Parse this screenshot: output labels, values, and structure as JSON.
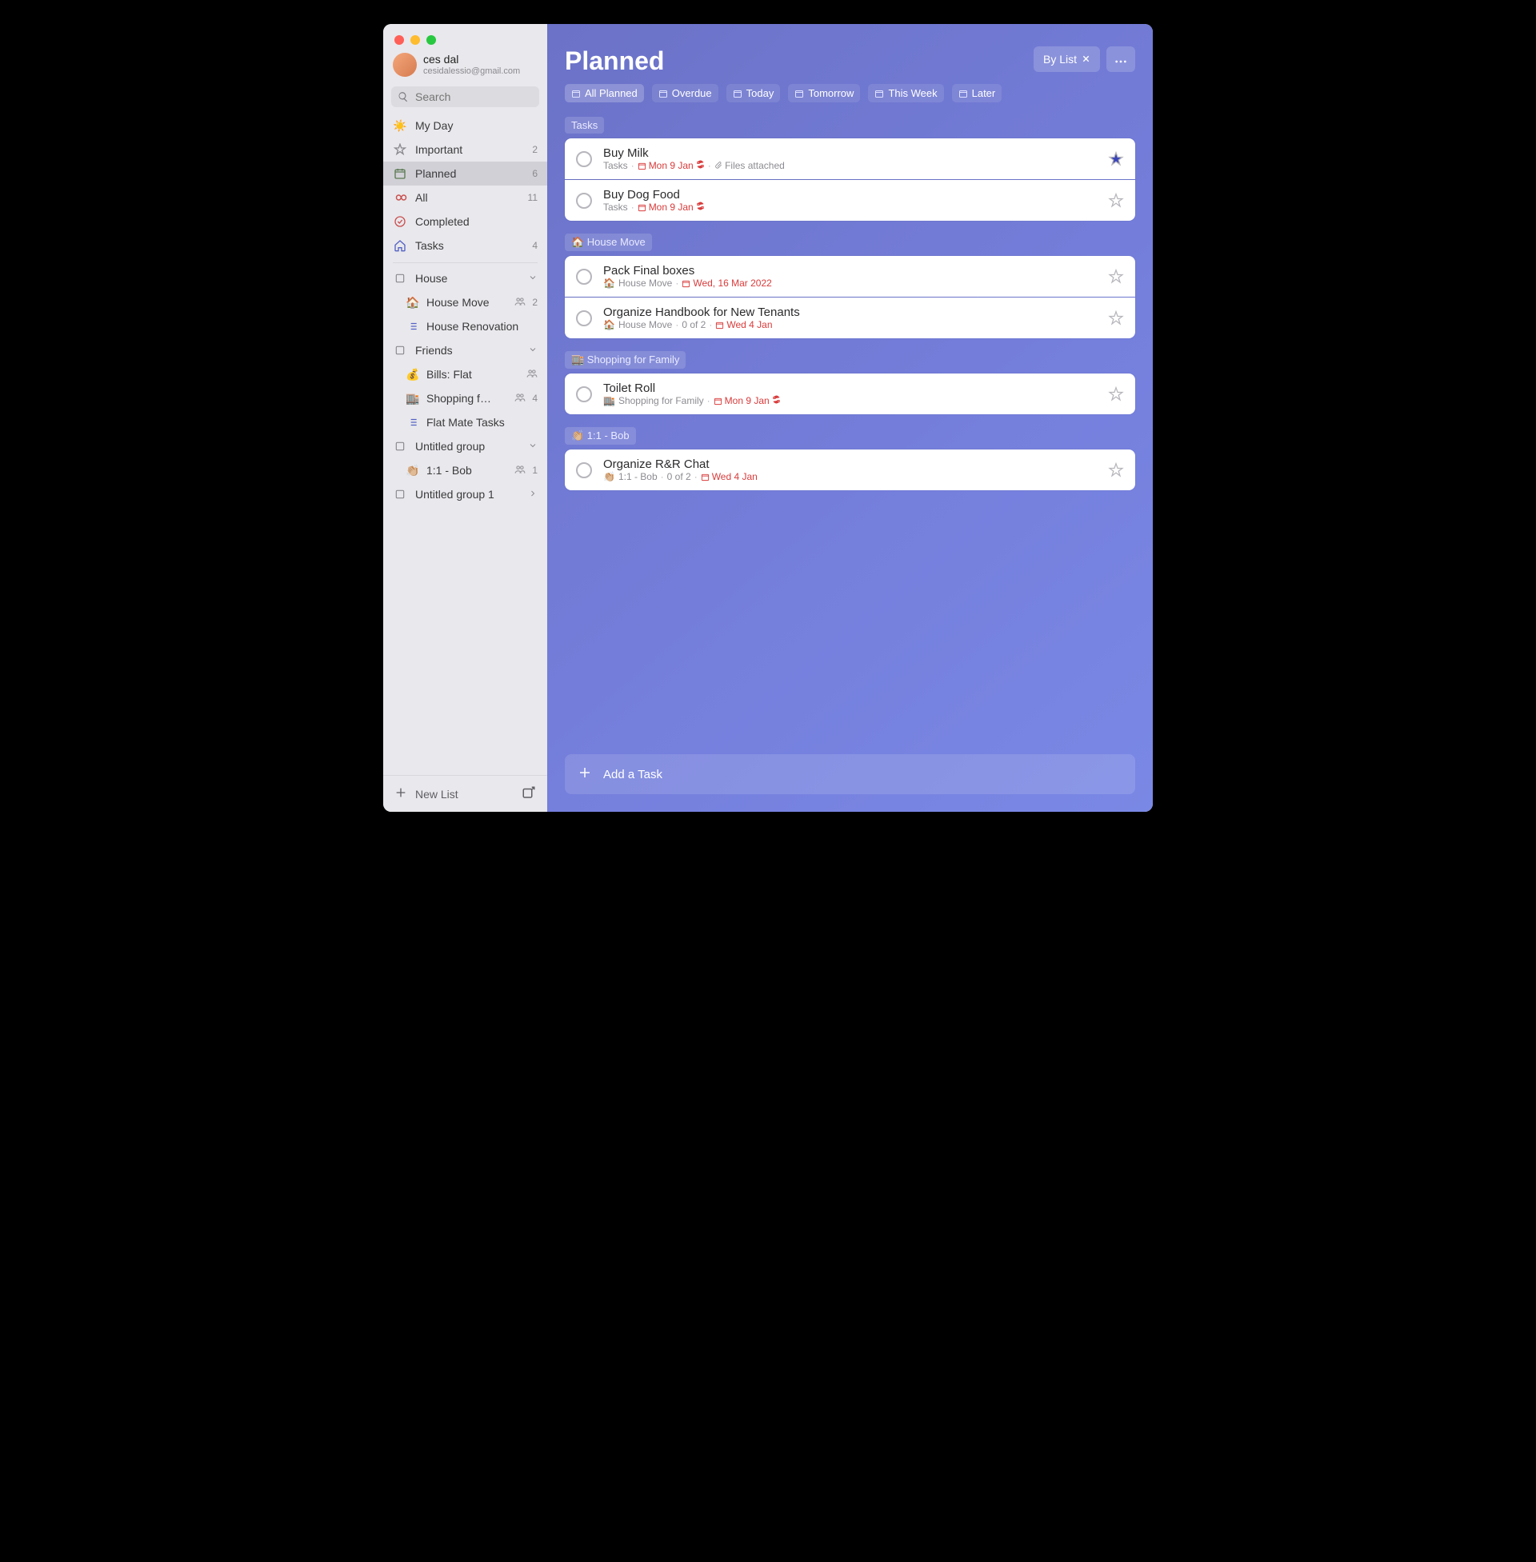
{
  "profile": {
    "name": "ces dal",
    "email": "cesidalessio@gmail.com"
  },
  "search": {
    "placeholder": "Search"
  },
  "smart": {
    "myday": {
      "label": "My Day",
      "count": ""
    },
    "important": {
      "label": "Important",
      "count": "2"
    },
    "planned": {
      "label": "Planned",
      "count": "6"
    },
    "all": {
      "label": "All",
      "count": "11"
    },
    "completed": {
      "label": "Completed",
      "count": ""
    },
    "tasks": {
      "label": "Tasks",
      "count": "4"
    }
  },
  "folders": {
    "house": {
      "label": "House",
      "items": {
        "move": {
          "emoji": "🏠",
          "label": "House Move",
          "count": "2"
        },
        "reno": {
          "label": "House Renovation"
        }
      }
    },
    "friends": {
      "label": "Friends",
      "items": {
        "bills": {
          "emoji": "💰",
          "label": "Bills: Flat"
        },
        "shopping": {
          "emoji": "🏬",
          "label": "Shopping f…",
          "count": "4"
        },
        "flatmate": {
          "label": "Flat Mate Tasks"
        }
      }
    },
    "ug": {
      "label": "Untitled group",
      "items": {
        "bob": {
          "emoji": "👏🏼",
          "label": "1:1 - Bob",
          "count": "1"
        }
      }
    },
    "ug1": {
      "label": "Untitled group 1"
    }
  },
  "newList": "New List",
  "page": {
    "title": "Planned",
    "byList": "By List"
  },
  "filters": {
    "all": "All Planned",
    "overdue": "Overdue",
    "today": "Today",
    "tomorrow": "Tomorrow",
    "thisweek": "This Week",
    "later": "Later"
  },
  "groupLabels": {
    "tasks": "Tasks",
    "move": "🏠 House Move",
    "shopping": "🏬 Shopping for Family",
    "bob": "👏🏼 1:1 - Bob"
  },
  "tasks": {
    "milk": {
      "title": "Buy Milk",
      "list": "Tasks",
      "date": "Mon 9 Jan",
      "attach": "Files attached"
    },
    "dog": {
      "title": "Buy Dog Food",
      "list": "Tasks",
      "date": "Mon 9 Jan"
    },
    "pack": {
      "title": "Pack Final boxes",
      "emoji": "🏠",
      "list": "House Move",
      "date": "Wed, 16 Mar 2022"
    },
    "handbook": {
      "title": "Organize Handbook for New Tenants",
      "emoji": "🏠",
      "list": "House Move",
      "progress": "0 of 2",
      "date": "Wed 4 Jan"
    },
    "toilet": {
      "title": "Toilet Roll",
      "emoji": "🏬",
      "list": "Shopping for Family",
      "date": "Mon 9 Jan"
    },
    "rr": {
      "title": "Organize R&R Chat",
      "emoji": "👏🏼",
      "list": "1:1 - Bob",
      "progress": "0 of 2",
      "date": "Wed 4 Jan"
    }
  },
  "addTask": "Add a Task"
}
